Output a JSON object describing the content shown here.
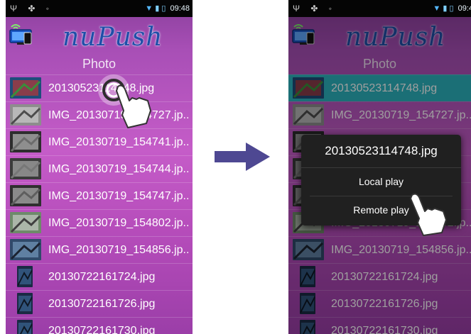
{
  "status_bar": {
    "time": "09:48",
    "time_right": "09:4"
  },
  "app": {
    "title": "nuPush"
  },
  "section_title": "Photo",
  "left_list": [
    {
      "name": "20130523114748.jpg",
      "thumb": "wide"
    },
    {
      "name": "IMG_20130719_154727.jp..",
      "thumb": "wide"
    },
    {
      "name": "IMG_20130719_154741.jp..",
      "thumb": "wide"
    },
    {
      "name": "IMG_20130719_154744.jp..",
      "thumb": "wide"
    },
    {
      "name": "IMG_20130719_154747.jp..",
      "thumb": "wide"
    },
    {
      "name": "IMG_20130719_154802.jp..",
      "thumb": "wide"
    },
    {
      "name": "IMG_20130719_154856.jp..",
      "thumb": "wide"
    },
    {
      "name": "20130722161724.jpg",
      "thumb": "narrow"
    },
    {
      "name": "20130722161726.jpg",
      "thumb": "narrow"
    },
    {
      "name": "20130722161730.jpg",
      "thumb": "narrow"
    }
  ],
  "right_list": [
    {
      "name": "20130523114748.jpg",
      "thumb": "wide"
    },
    {
      "name": "IMG_20130719_154727.jp..",
      "thumb": "wide"
    },
    {
      "name": "",
      "thumb": "wide"
    },
    {
      "name": "",
      "thumb": "wide"
    },
    {
      "name": "",
      "thumb": "wide"
    },
    {
      "name": "IMG_20130719_154802.jp..",
      "thumb": "wide"
    },
    {
      "name": "IMG_20130719_154856.jp..",
      "thumb": "wide"
    },
    {
      "name": "20130722161724.jpg",
      "thumb": "narrow"
    },
    {
      "name": "20130722161726.jpg",
      "thumb": "narrow"
    },
    {
      "name": "20130722161730.jpg",
      "thumb": "narrow"
    }
  ],
  "context_menu": {
    "title": "20130523114748.jpg",
    "item_local": "Local play",
    "item_remote": "Remote play"
  },
  "colors": {
    "selection": "#2cb3be",
    "arrow": "#4e4892",
    "title_blue": "#1f4ea8"
  },
  "icons": [
    "wifi-icon",
    "battery-icon",
    "usb-icon",
    "settings-icon",
    "android-icon",
    "tv-cast-icon",
    "hand-pointer-icon",
    "arrow-right-icon"
  ]
}
